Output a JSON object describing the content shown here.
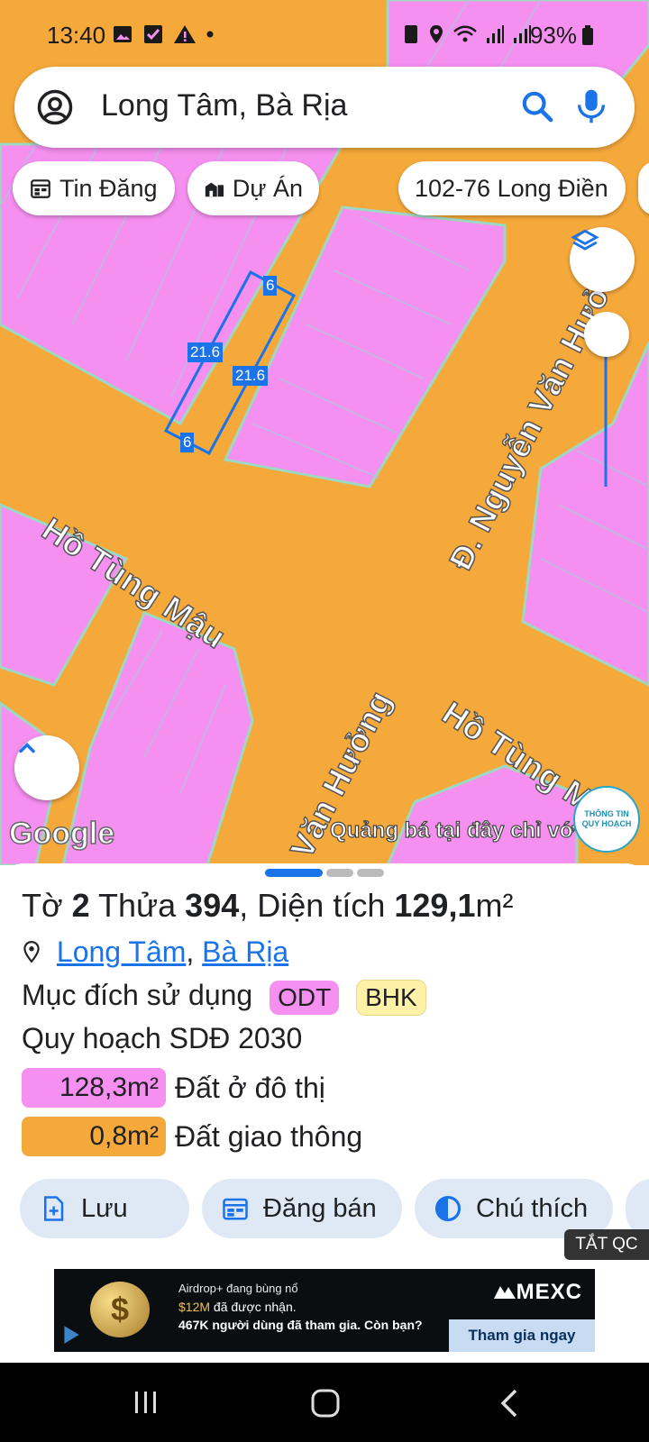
{
  "status_bar": {
    "time": "13:40",
    "battery": "93%"
  },
  "search": {
    "query": "Long Tâm, Bà Rịa"
  },
  "chips": [
    {
      "label": "Tin Đăng",
      "icon": "calendar-icon"
    },
    {
      "label": "Dự Án",
      "icon": "buildings-icon"
    },
    {
      "label": "102-76 Long Điền",
      "icon": ""
    }
  ],
  "map": {
    "plot_labels": {
      "top": "6",
      "left": "21.6",
      "right": "21.6",
      "bottom": "6"
    },
    "roads": {
      "ho_tung_mau_1": "Hồ Tùng Mậu",
      "ho_tung_mau_2": "Hồ Tùng Mậu",
      "nguyen_van_huong_1": "Đ. Nguyễn Văn Hưởng",
      "nguyen_van_huong_2": "Văn Hưởng"
    },
    "google_logo": "Google",
    "promo_text": "Quảng bá tại đây chỉ vớ",
    "qh_badge": {
      "line1": "THÔNG TIN",
      "line2": "QUY HOẠCH"
    },
    "colors": {
      "land": "#f58ff0",
      "road": "#f6a93b",
      "plot_outline": "#1a73e8"
    }
  },
  "parcel": {
    "sheet_label": "Tờ",
    "sheet_no": "2",
    "plot_label": "Thửa",
    "plot_no": "394",
    "area_label": "Diện tích",
    "area_value": "129,1",
    "area_unit": "m²",
    "location": {
      "ward": "Long Tâm",
      "city": "Bà Rịa",
      "separator": ", "
    },
    "purpose_label": "Mục đích sử dụng",
    "purpose_tags": [
      {
        "code": "ODT",
        "color": "#f58ff0"
      },
      {
        "code": "BHK",
        "color": "#fff1a8"
      }
    ],
    "plan_title": "Quy hoạch SDĐ 2030",
    "plan_areas": [
      {
        "value": "128,3m²",
        "label": "Đất ở đô thị",
        "color": "#f58ff0"
      },
      {
        "value": "0,8m²",
        "label": "Đất giao thông",
        "color": "#f6a93b"
      }
    ]
  },
  "actions": [
    {
      "label": "Lưu",
      "icon": "save-icon"
    },
    {
      "label": "Đăng bán",
      "icon": "post-icon"
    },
    {
      "label": "Chú thích",
      "icon": "legend-icon"
    }
  ],
  "ad_close": "TẮT QC",
  "ad": {
    "line1": "Airdrop+ đang bùng nổ",
    "line2_amount": "$12M",
    "line2_rest": " đã được nhận.",
    "line3": "467K người dùng đã tham gia. Còn bạn?",
    "brand": "MEXC",
    "cta": "Tham gia ngay",
    "coin": "$"
  }
}
